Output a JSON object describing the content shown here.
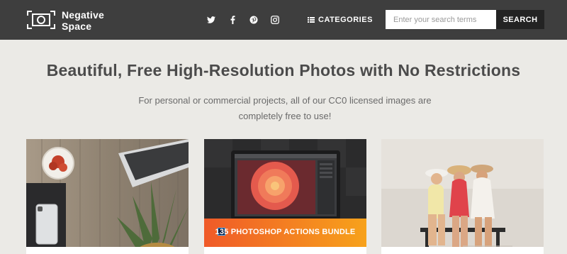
{
  "brand": {
    "name_line1": "Negative",
    "name_line2": "Space"
  },
  "nav": {
    "social_icons": [
      "twitter-icon",
      "facebook-icon",
      "pinterest-icon",
      "instagram-icon"
    ],
    "categories_label": "CATEGORIES"
  },
  "search": {
    "placeholder": "Enter your search terms",
    "button_label": "SEARCH"
  },
  "hero": {
    "title": "Beautiful, Free High-Resolution Photos with No Restrictions",
    "subtitle": "For personal or commercial projects, all of our CC0 licensed images are completely free to use!"
  },
  "cards": [
    {
      "subject": "desk-flatlay-photo"
    },
    {
      "subject": "laptop-flower-photo",
      "banner_text": "135 PHOTOSHOP ACTIONS BUNDLE"
    },
    {
      "subject": "women-on-bench-photo"
    }
  ],
  "colors": {
    "topbar": "#3e3e3e",
    "page_bg": "#ebeae6",
    "search_button": "#232323",
    "banner_start": "#f05a28",
    "banner_end": "#f7a21b"
  }
}
